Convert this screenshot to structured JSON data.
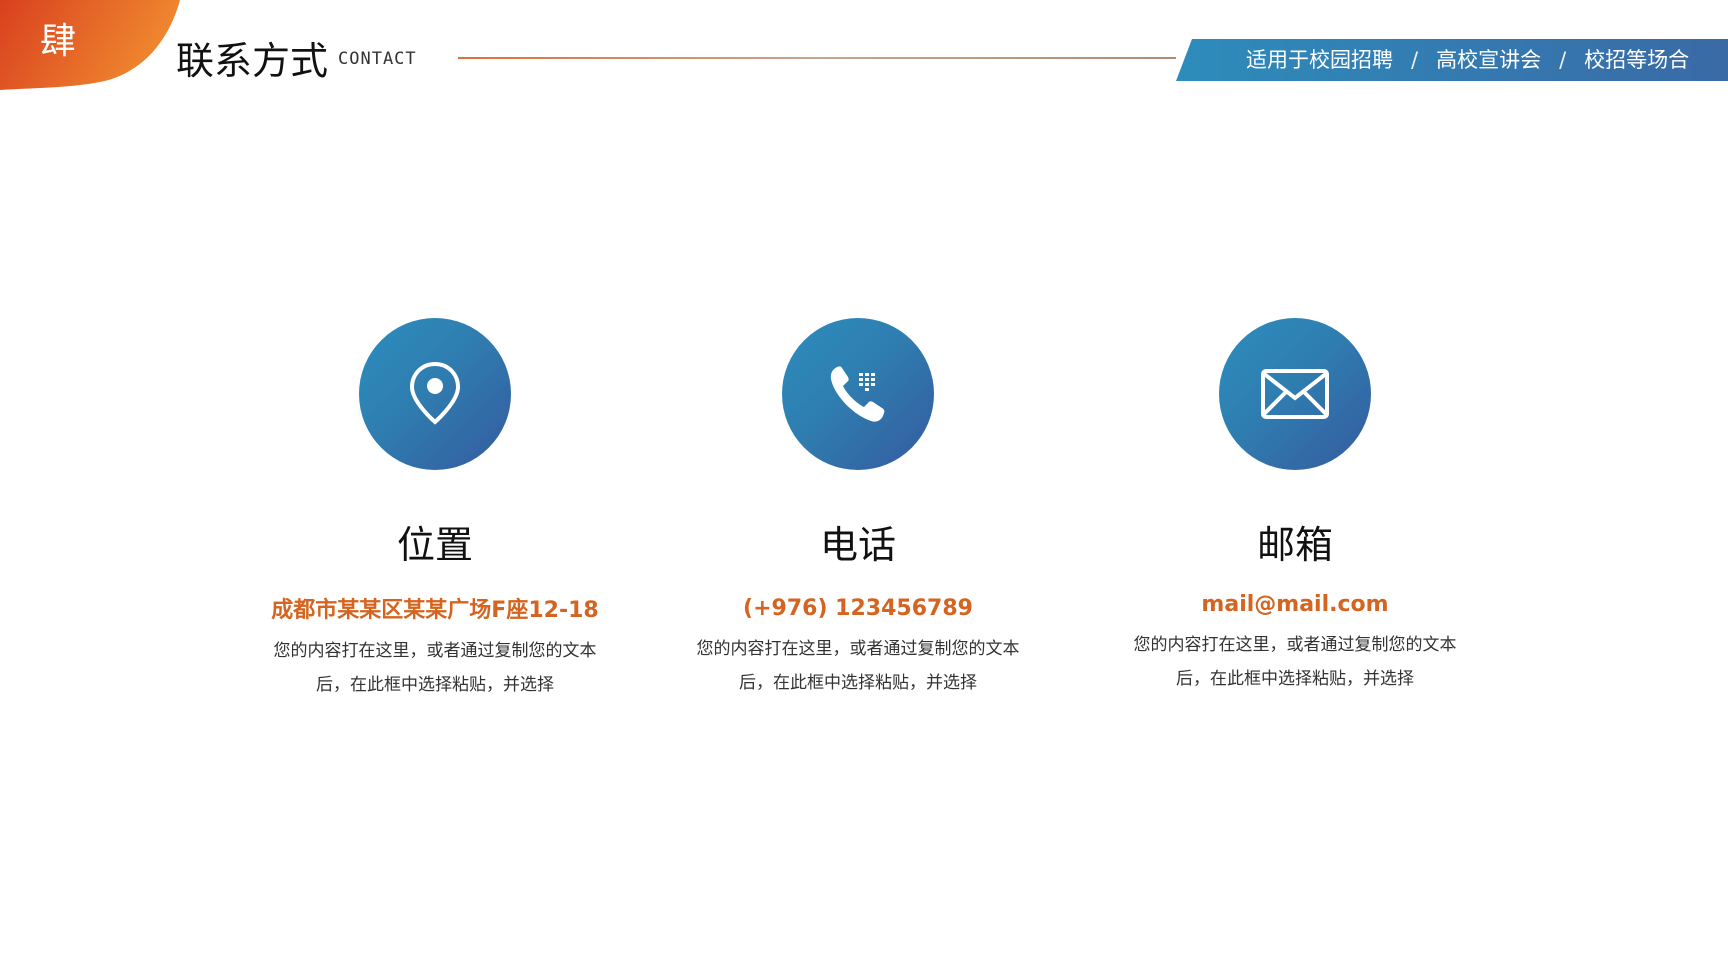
{
  "header": {
    "badge": "肆",
    "title": "联系方式",
    "subtitle": "CONTACT",
    "banner": {
      "items": [
        "适用于校园招聘",
        "高校宣讲会",
        "校招等场合"
      ],
      "separator": "/"
    },
    "colors": {
      "badge_start": "#d9401f",
      "badge_end": "#f08a2f",
      "banner_start": "#2d8cbb",
      "banner_end": "#3a6aa6"
    }
  },
  "cards": [
    {
      "icon": "location-pin-icon",
      "title": "位置",
      "highlight": "成都市某某区某某广场F座12-18",
      "desc_line1": "您的内容打在这里，或者通过复制您的文本",
      "desc_line2": "后，在此框中选择粘贴，并选择"
    },
    {
      "icon": "phone-icon",
      "title": "电话",
      "highlight": "(+976) 123456789",
      "desc_line1": "您的内容打在这里，或者通过复制您的文本",
      "desc_line2": "后，在此框中选择粘贴，并选择"
    },
    {
      "icon": "mail-icon",
      "title": "邮箱",
      "highlight": "mail@mail.com",
      "desc_line1": "您的内容打在这里，或者通过复制您的文本",
      "desc_line2": "后，在此框中选择粘贴，并选择"
    }
  ],
  "accent_color": "#d4641f"
}
